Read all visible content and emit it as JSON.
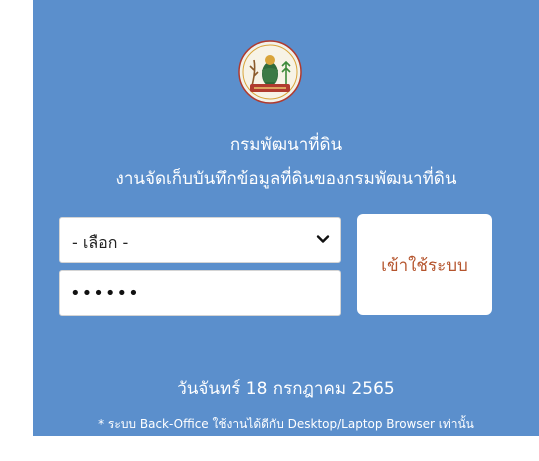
{
  "header": {
    "logo_icon": "land-development-department-seal",
    "org_name": "กรมพัฒนาที่ดิน",
    "subtitle": "งานจัดเก็บบันทึกข้อมูลที่ดินของกรมพัฒนาที่ดิน"
  },
  "form": {
    "select_value": "- เลือก -",
    "password_value": "••••••",
    "login_label": "เข้าใช้ระบบ"
  },
  "footer": {
    "date": "วันจันทร์ 18 กรกฎาคม 2565",
    "note": "* ระบบ Back-Office ใช้งานได้ดีกับ Desktop/Laptop Browser เท่านั้น"
  },
  "colors": {
    "panel_bg": "#5b8fcc",
    "button_text": "#b5552e"
  }
}
